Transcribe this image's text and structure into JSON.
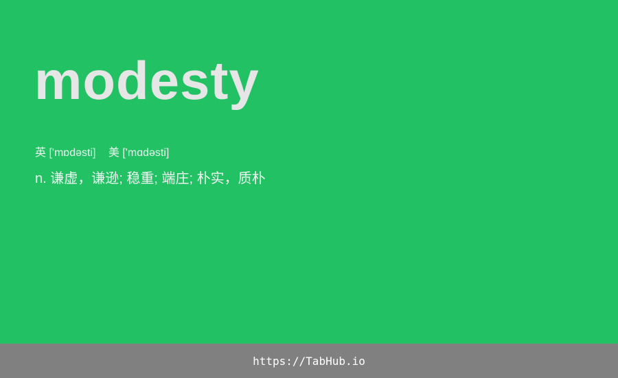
{
  "theme": {
    "background": "#21c164",
    "footer_background": "#808080",
    "word_color": "#e6e6e6"
  },
  "entry": {
    "word": "modesty",
    "uk_label": "英",
    "uk_phonetic": "['mɒdəsti]",
    "us_label": "美",
    "us_phonetic": "['mɑdəsti]",
    "definition": "n. 谦虚，谦逊; 稳重; 端庄; 朴实，质朴"
  },
  "footer": {
    "link_text": "https://TabHub.io"
  }
}
